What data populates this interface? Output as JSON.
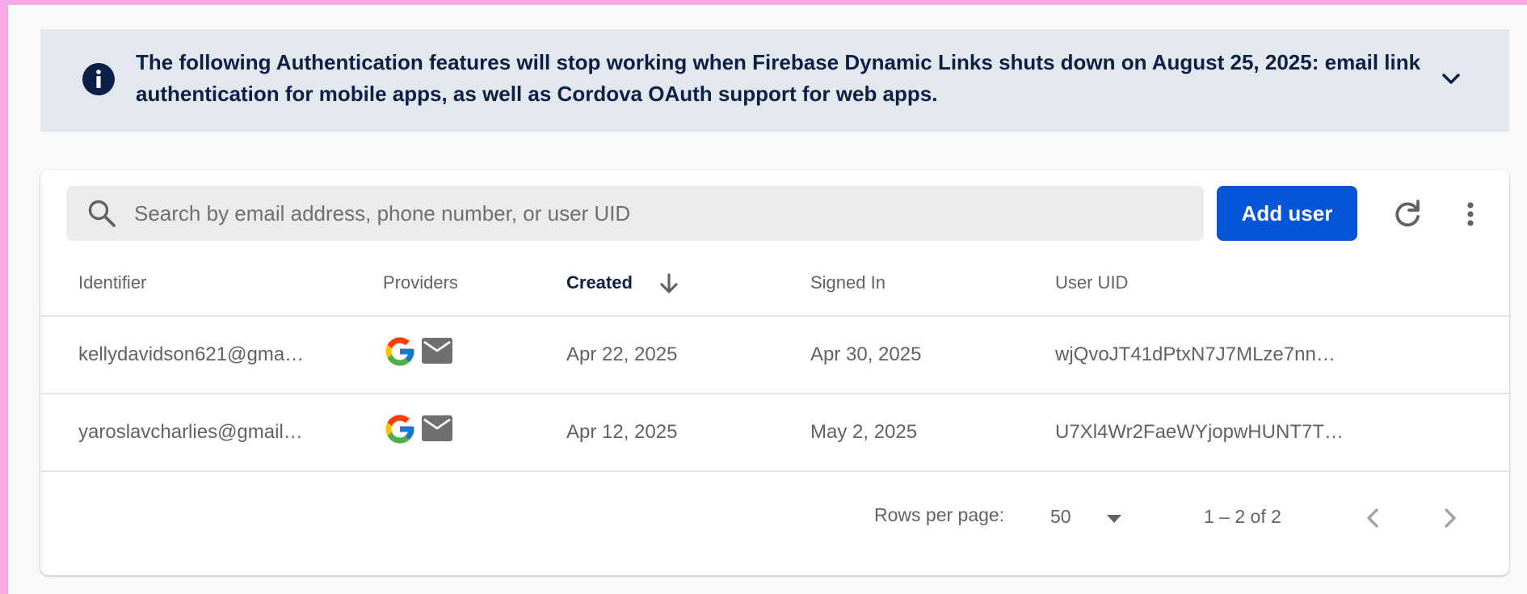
{
  "banner": {
    "text": "The following Authentication features will stop working when Firebase Dynamic Links shuts down on August 25, 2025: email link authentication for mobile apps, as well as Cordova OAuth support for web apps."
  },
  "toolbar": {
    "search_placeholder": "Search by email address, phone number, or user UID",
    "search_value": "",
    "add_user_label": "Add user"
  },
  "table": {
    "columns": {
      "identifier": "Identifier",
      "providers": "Providers",
      "created": "Created",
      "signed_in": "Signed In",
      "user_uid": "User UID"
    },
    "rows": [
      {
        "identifier": "kellydavidson621@gma…",
        "providers": [
          "google-icon",
          "mail-icon"
        ],
        "created": "Apr 22, 2025",
        "signed_in": "Apr 30, 2025",
        "user_uid": "wjQvoJT41dPtxN7J7MLze7nn…"
      },
      {
        "identifier": "yaroslavcharlies@gmail…",
        "providers": [
          "google-icon",
          "mail-icon"
        ],
        "created": "Apr 12, 2025",
        "signed_in": "May 2, 2025",
        "user_uid": "U7Xl4Wr2FaeWYjopwHUNT7T…"
      }
    ]
  },
  "pagination": {
    "rows_per_page_label": "Rows per page:",
    "rows_per_page_value": "50",
    "range": "1 – 2 of 2"
  },
  "colors": {
    "accent": "#0655d8",
    "banner_bg": "#e3e8ee",
    "banner_text": "#0b1f47",
    "outer_border": "#f6a9e6"
  }
}
